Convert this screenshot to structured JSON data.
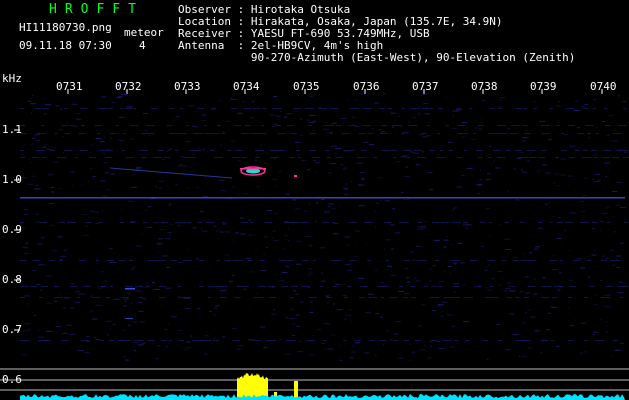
{
  "header": {
    "title": "HROFFT",
    "filename": "HI11180730.png",
    "datetime": "09.11.18 07:30",
    "meteor_label": "meteor",
    "meteor_count": "4",
    "info_lines": [
      "Observer : Hirotaka Otsuka",
      "Location : Hirakata, Osaka, Japan (135.7E, 34.9N)",
      "Receiver : YAESU FT-690 53.749MHz, USB",
      "Antenna  : 2el-HB9CV, 4m's high",
      "           90-270-Azimuth (East-West), 90-Elevation (Zenith)"
    ]
  },
  "chart_data": {
    "type": "heatmap",
    "title": "",
    "ylabel": "kHz",
    "xlabel": "",
    "x_ticks": [
      "0731",
      "0732",
      "0733",
      "0734",
      "0735",
      "0736",
      "0737",
      "0738",
      "0739",
      "0740"
    ],
    "y_ticks": [
      "1.1",
      "1.0",
      "0.9",
      "0.8",
      "0.7",
      "0.6"
    ],
    "ylim": [
      0.58,
      1.15
    ],
    "colors": {
      "background": "#000000",
      "noise": "#1a1a6e",
      "carrier": "#3a4fd8",
      "meteor_echo": "#ff3399",
      "meteor_core": "#33ffee",
      "level_trace": "#ffff00",
      "noise_trace": "#00e0ff",
      "title": "#00ff22"
    },
    "features": {
      "carrier_khz": 0.965,
      "meteor_echo": {
        "time": "0734",
        "freq_khz": 1.02
      }
    }
  }
}
